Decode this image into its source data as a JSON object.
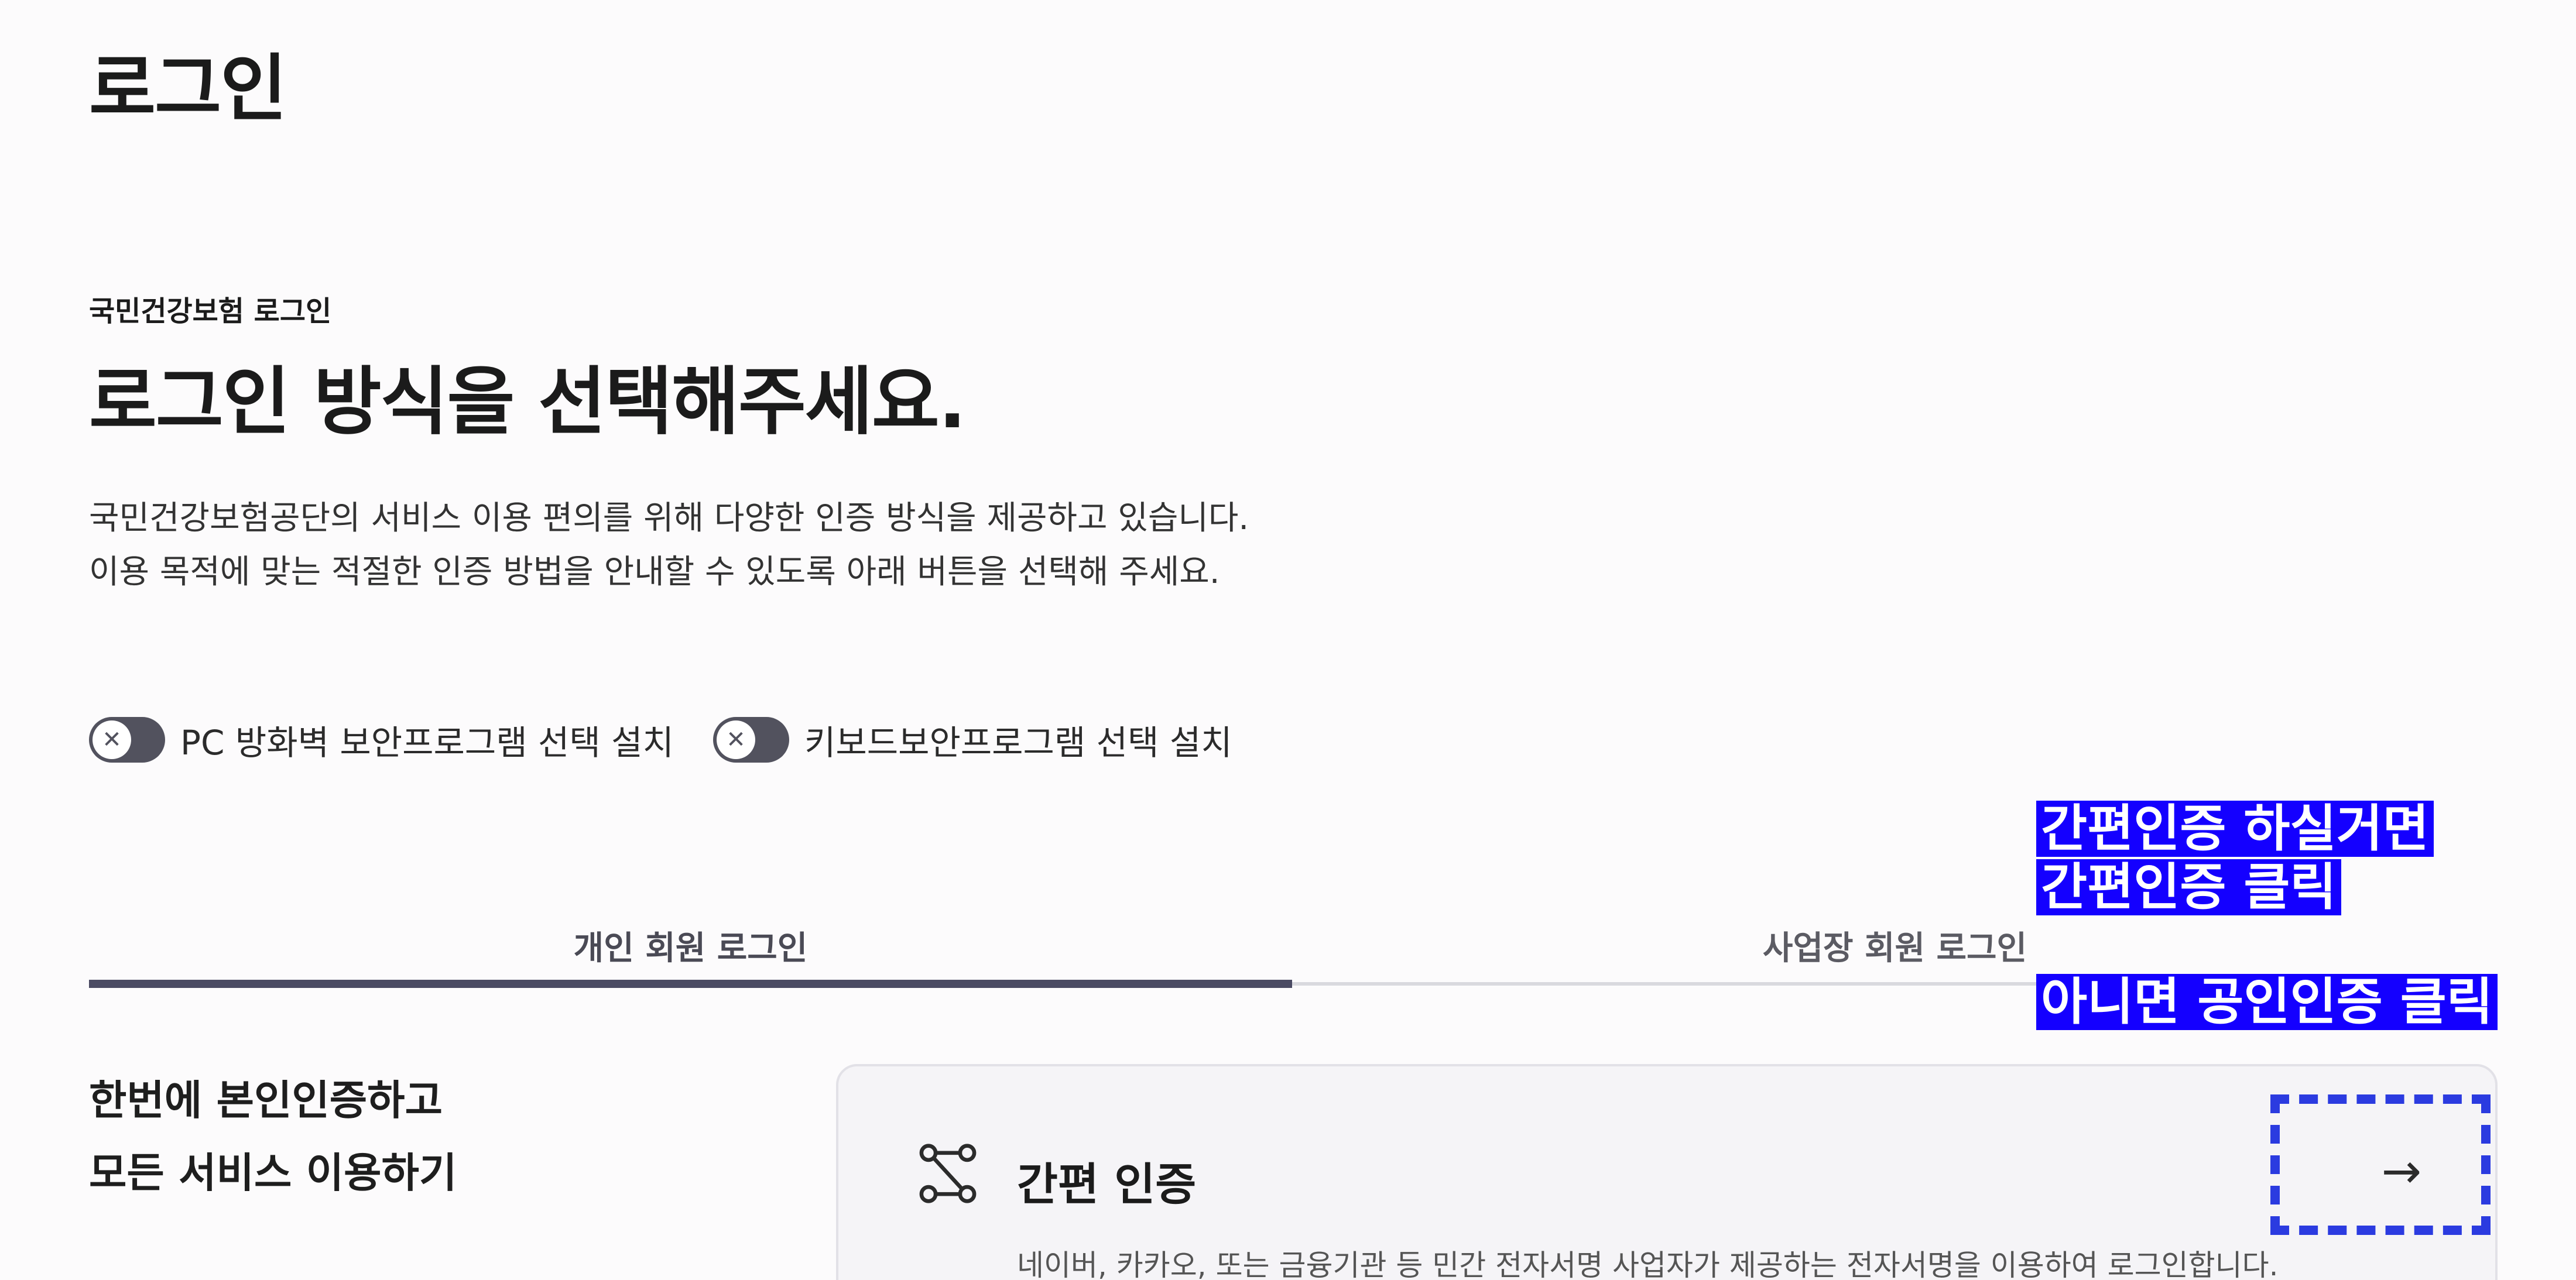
{
  "page": {
    "title": "로그인",
    "eyebrow": "국민건강보험 로그인",
    "headline": "로그인 방식을 선택해주세요.",
    "description_lines": [
      "국민건강보험공단의 서비스 이용 편의를 위해 다양한 인증 방식을 제공하고 있습니다.",
      "이용 목적에 맞는 적절한 인증 방법을 안내할 수 있도록 아래 버튼을 선택해 주세요."
    ]
  },
  "toggles": [
    {
      "label": "PC 방화벽 보안프로그램 선택 설치",
      "icon": "close-icon",
      "state": "off"
    },
    {
      "label": "키보드보안프로그램 선택 설치",
      "icon": "close-icon",
      "state": "off"
    }
  ],
  "tabs": [
    {
      "label": "개인 회원 로그인",
      "active": true
    },
    {
      "label": "사업장 회원 로그인",
      "active": false
    }
  ],
  "side_text": {
    "line1": "한번에 본인인증하고",
    "line2": "모든 서비스 이용하기"
  },
  "card": {
    "icon": "simple-auth-icon",
    "title": "간편 인증",
    "description": "네이버, 카카오, 또는 금융기관 등 민간 전자서명 사업자가 제공하는 전자서명을 이용하여 로그인합니다.",
    "arrow": "→"
  },
  "annotations": {
    "line1": "간편인증 하실거면",
    "line2": "간편인증 클릭",
    "line3": "아니면 공인인증 클릭",
    "highlight_color": "#1400ff",
    "dash_color": "#2b3be0"
  },
  "colors": {
    "background": "#fcfbfc",
    "toggle": "#52525e",
    "active_tab_underline": "#4b4b63",
    "card_background": "#f5f4f7"
  }
}
